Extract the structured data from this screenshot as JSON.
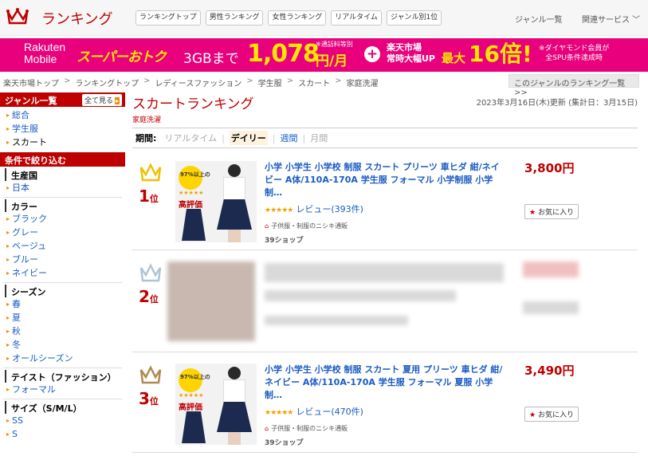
{
  "header": {
    "title": "ランキング",
    "nav": [
      "ランキングトップ",
      "男性ランキング",
      "女性ランキング",
      "リアルタイム",
      "ジャンル別1位"
    ],
    "genre_link": "ジャンル一覧",
    "service_link": "関連サービス ﹀"
  },
  "banner": {
    "brand": "Rakuten\nMobile",
    "promo": "スーパーおトク",
    "gb": "3GBまで",
    "note": "※通話料等別",
    "price": "1,078",
    "unit": "円/月",
    "plus": "+",
    "rakuten": "楽天市場\n常時大幅UP",
    "max": "最大",
    "pct": "16倍!",
    "dia": "※ダイヤモンド会員が\n全SPU条件達成時"
  },
  "breadcrumb": [
    "楽天市場トップ",
    "ランキングトップ",
    "レディースファッション",
    "学生服",
    "スカート",
    "家庭洗濯"
  ],
  "breadcrumb_sep": ">",
  "genre_list_btn": "このジャンルのランキング一覧 >>",
  "sidebar": {
    "genre_head": "ジャンル一覧",
    "see_all": "全て見る",
    "genres": [
      "総合",
      "学生服",
      "スカート"
    ],
    "filter_head": "条件で絞り込む",
    "sections": [
      {
        "label": "生産国",
        "items": [
          "日本"
        ]
      },
      {
        "label": "カラー",
        "items": [
          "ブラック",
          "グレー",
          "ベージュ",
          "ブルー",
          "ネイビー"
        ]
      },
      {
        "label": "シーズン",
        "items": [
          "春",
          "夏",
          "秋",
          "冬",
          "オールシーズン"
        ]
      },
      {
        "label": "テイスト（ファッション）",
        "items": [
          "フォーマル"
        ]
      },
      {
        "label": "サイズ（S/M/L）",
        "items": [
          "SS",
          "S"
        ]
      }
    ]
  },
  "main": {
    "title": "スカートランキング",
    "sub": "家庭洗濯",
    "updated": "2023年3月16日(木)更新 (集計日：3月15日)",
    "period_label": "期間:",
    "periods": [
      "リアルタイム",
      "デイリー",
      "週間",
      "月間"
    ],
    "period_sep": "|"
  },
  "items": [
    {
      "rank": "1",
      "rank_suffix": "位",
      "rank_color": "#f0c000",
      "name": "小学 小学生 小学校 制服 スカート プリーツ 車ヒダ 紺/ネイビー A体/110A-170A 学生服 フォーマル 小学制服 小学制…",
      "review": "レビュー(393件)",
      "stars": "★★★★★",
      "shop": "子供服・制服のニシキ通販",
      "shop39": "39ショップ",
      "price": "3,800円",
      "fav": "お気に入り",
      "thumb_pct": "97%以上の",
      "thumb_text": "高評価"
    },
    {
      "rank": "2",
      "rank_suffix": "位",
      "rank_color": "#b0c4d4"
    },
    {
      "rank": "3",
      "rank_suffix": "位",
      "rank_color": "#b08a50",
      "name": "小学 小学生 小学校 制服 スカート 夏用 プリーツ 車ヒダ 紺/ネイビー A体/110A-170A 学生服 フォーマル 夏服 小学制…",
      "review": "レビュー(470件)",
      "stars": "★★★★★",
      "shop": "子供服・制服のニシキ通販",
      "shop39": "39ショップ",
      "price": "3,490円",
      "fav": "お気に入り",
      "thumb_pct": "97%以上の",
      "thumb_text": "高評価"
    }
  ],
  "colors": {
    "brand": "#bf0000",
    "banner": "#e8007c",
    "link": "#1a5bc4"
  },
  "icons": [
    "crown-icon",
    "plus-icon",
    "star-icon",
    "house-icon"
  ]
}
